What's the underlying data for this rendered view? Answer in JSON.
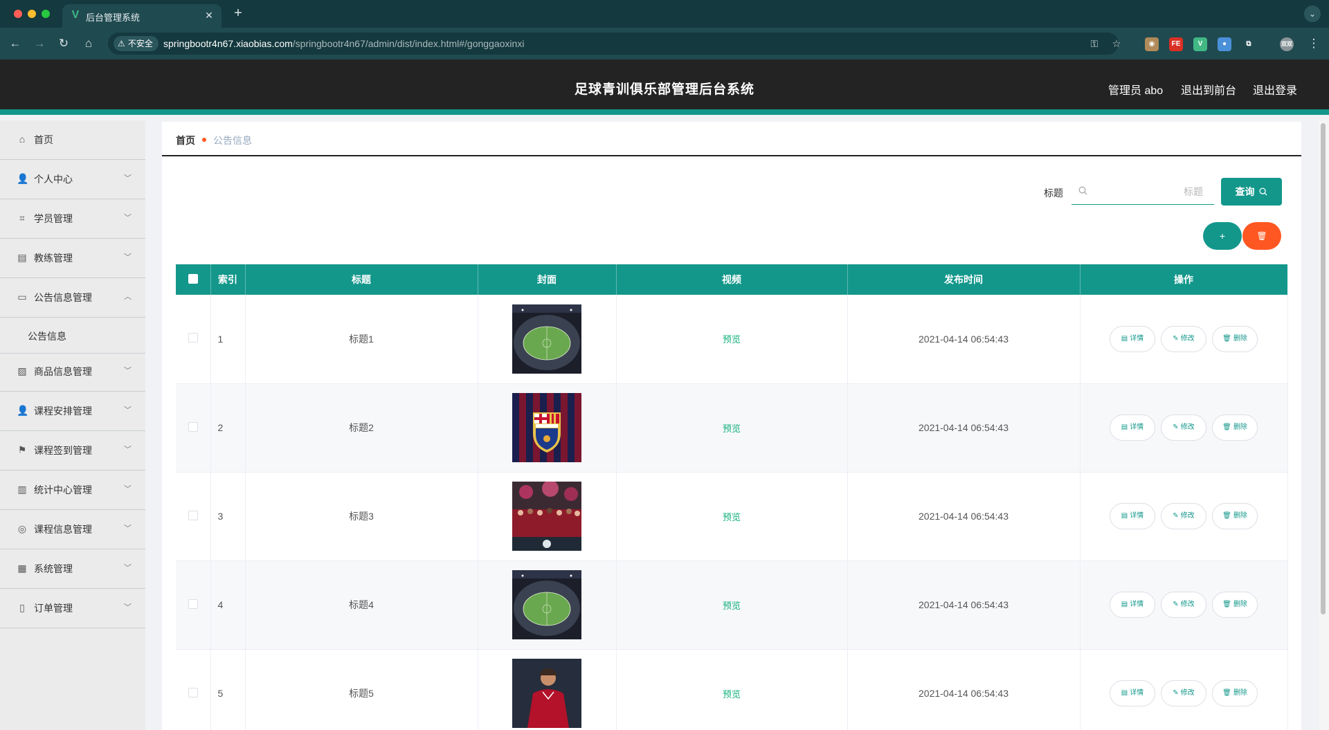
{
  "browser": {
    "tab_title": "后台管理系统",
    "tab_favicon": "V",
    "security_label": "不安全",
    "url_host": "springbootr4n67.xiaobias.com",
    "url_path": "/springbootr4n67/admin/dist/index.html#/gonggaoxinxi",
    "extensions": [
      {
        "name": "ext-cookie-icon",
        "label": "◉",
        "color": "#b08a5a"
      },
      {
        "name": "ext-fe-icon",
        "label": "FE",
        "color": "#d93025"
      },
      {
        "name": "ext-vue-icon",
        "label": "V",
        "color": "#41b883"
      },
      {
        "name": "ext-pin-icon",
        "label": "●",
        "color": "#4a90d9"
      },
      {
        "name": "ext-puzzle-icon",
        "label": "⧉",
        "color": "#1f4a50"
      },
      {
        "name": "profile-avatar",
        "label": "双双",
        "color": "#8a9599"
      }
    ]
  },
  "header": {
    "title": "足球青训俱乐部管理后台系统",
    "admin_label": "管理员 abo",
    "front_link": "退出到前台",
    "logout_link": "退出登录",
    "accent_color": "#13978b"
  },
  "sidebar": {
    "items": [
      {
        "label": "首页",
        "icon": "home-icon",
        "expandable": false
      },
      {
        "label": "个人中心",
        "icon": "user-icon",
        "expandable": true
      },
      {
        "label": "学员管理",
        "icon": "crop-icon",
        "expandable": true
      },
      {
        "label": "教练管理",
        "icon": "briefcase-icon",
        "expandable": true
      },
      {
        "label": "公告信息管理",
        "icon": "message-icon",
        "expandable": true,
        "open": true
      },
      {
        "label": "商品信息管理",
        "icon": "chart-icon",
        "expandable": true
      },
      {
        "label": "课程安排管理",
        "icon": "user-icon",
        "expandable": true
      },
      {
        "label": "课程签到管理",
        "icon": "flag-icon",
        "expandable": true
      },
      {
        "label": "统计中心管理",
        "icon": "bar-chart-icon",
        "expandable": true
      },
      {
        "label": "课程信息管理",
        "icon": "compass-icon",
        "expandable": true
      },
      {
        "label": "系统管理",
        "icon": "clipboard-icon",
        "expandable": true
      },
      {
        "label": "订单管理",
        "icon": "mic-icon",
        "expandable": true
      }
    ],
    "submenu_label": "公告信息"
  },
  "breadcrumb": {
    "home": "首页",
    "current": "公告信息"
  },
  "search": {
    "label": "标题",
    "placeholder": "标题",
    "value": "",
    "query_button": "查询"
  },
  "actions": {
    "add": "+",
    "delete_icon": "trash-icon"
  },
  "table": {
    "columns": [
      "索引",
      "标题",
      "封面",
      "视频",
      "发布时间",
      "操作"
    ],
    "preview_label": "预览",
    "detail_label": "详情",
    "edit_label": "修改",
    "delete_label": "删除",
    "rows": [
      {
        "index": "1",
        "title": "标题1",
        "cover": "stadium-image",
        "time": "2021-04-14 06:54:43"
      },
      {
        "index": "2",
        "title": "标题2",
        "cover": "fcb-crest-image",
        "time": "2021-04-14 06:54:43"
      },
      {
        "index": "3",
        "title": "标题3",
        "cover": "team-celebration-image",
        "time": "2021-04-14 06:54:43"
      },
      {
        "index": "4",
        "title": "标题4",
        "cover": "stadium-image",
        "time": "2021-04-14 06:54:43"
      },
      {
        "index": "5",
        "title": "标题5",
        "cover": "player-image",
        "time": "2021-04-14 06:54:43"
      }
    ]
  }
}
